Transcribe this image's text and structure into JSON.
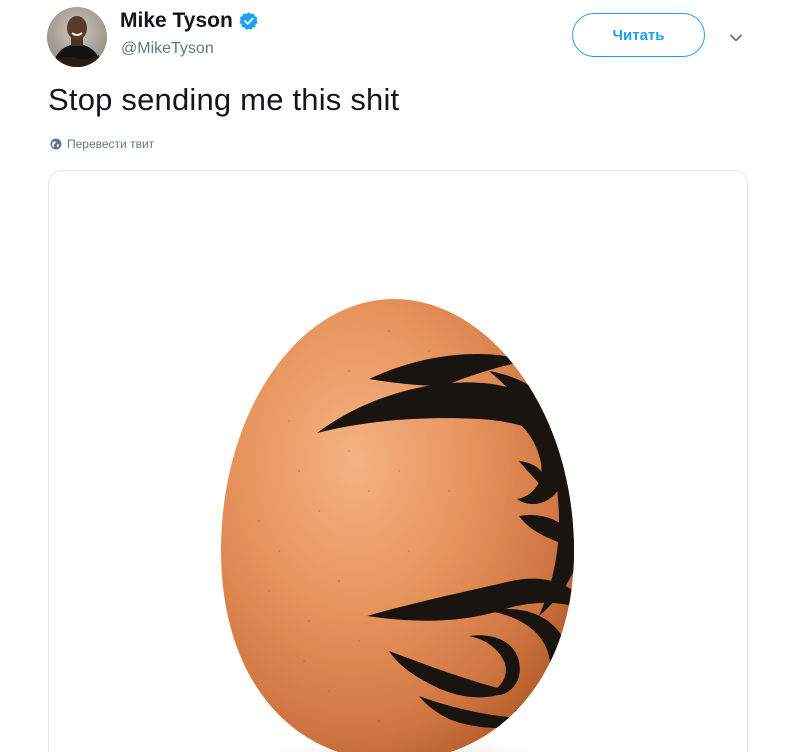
{
  "user": {
    "display_name": "Mike Tyson",
    "handle": "@MikeTyson",
    "verified": true
  },
  "follow_button": {
    "label": "Читать"
  },
  "tweet": {
    "text": "Stop sending me this shit",
    "translate_label": "Перевести твит"
  },
  "colors": {
    "accent": "#1da1f2",
    "secondary_text": "#657786",
    "egg": "#e7935a",
    "tattoo": "#1a1410"
  },
  "icons": {
    "verified": "verified-badge-icon",
    "caret": "chevron-down-icon",
    "translate": "globe-icon"
  }
}
